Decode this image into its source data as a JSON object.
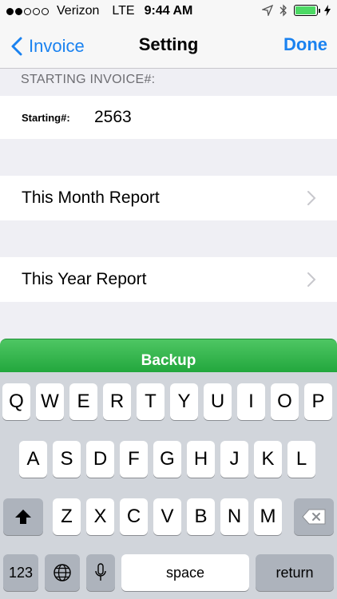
{
  "status_bar": {
    "carrier": "Verizon",
    "network": "LTE",
    "time": "9:44 AM",
    "signal_bars_filled": 2,
    "signal_bars_total": 5,
    "battery_level": 0.95,
    "icons": [
      "location-arrow-icon",
      "bluetooth-icon",
      "battery-icon",
      "charging-bolt-icon"
    ]
  },
  "nav": {
    "back_label": "Invoice",
    "title": "Setting",
    "done_label": "Done"
  },
  "section_header": "STARTING INVOICE#:",
  "starting": {
    "label": "Starting#:",
    "value": "2563"
  },
  "rows": {
    "month": "This Month Report",
    "year": "This Year Report"
  },
  "backup_label": "Backup",
  "colors": {
    "accent": "#1a82f0",
    "backup_green": "#2fb84a"
  },
  "keyboard": {
    "row1": [
      "Q",
      "W",
      "E",
      "R",
      "T",
      "Y",
      "U",
      "I",
      "O",
      "P"
    ],
    "row2": [
      "A",
      "S",
      "D",
      "F",
      "G",
      "H",
      "J",
      "K",
      "L"
    ],
    "row3": [
      "Z",
      "X",
      "C",
      "V",
      "B",
      "N",
      "M"
    ],
    "numbers": "123",
    "space": "space",
    "return": "return"
  }
}
